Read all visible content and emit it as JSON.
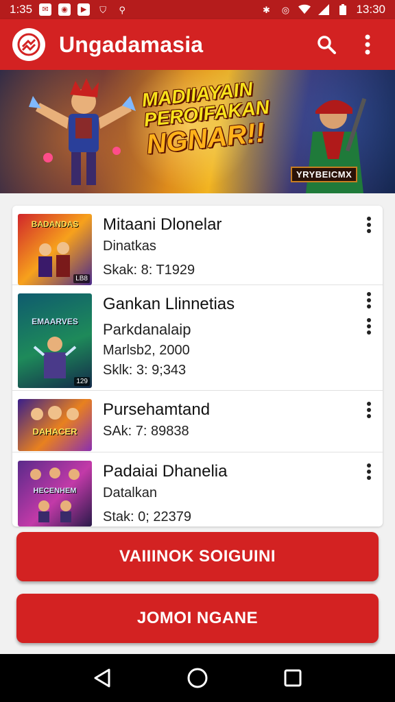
{
  "status_bar": {
    "time_left": "1:35",
    "time_right": "13:30",
    "left_icons": [
      "mail-icon",
      "camera-icon",
      "play-icon",
      "shield-icon",
      "usb-icon"
    ],
    "right_icons": [
      "bluetooth-icon",
      "vibrate-icon",
      "wifi-icon",
      "signal-icon",
      "battery-icon"
    ]
  },
  "app_bar": {
    "title": "Ungadamasia",
    "logo_icon": "app-logo-icon",
    "search_icon": "search-icon",
    "overflow_icon": "more-vert-icon"
  },
  "banner": {
    "headline_line1": "MADIIAYAIN",
    "headline_line2": "PEROIFAKAN",
    "headline_line3": "NGNAR!!",
    "tag": "YRYBEICMX"
  },
  "list": [
    {
      "title": "Mitaani Dlonelar",
      "line1": "Dinatkas",
      "meta": "Skak: 8: T1929",
      "thumb_label": "BADANDAS",
      "thumb_badge": "LB8",
      "thumb_colors": [
        "#d0262b",
        "#f7a11c",
        "#4a2a8c"
      ]
    },
    {
      "title": "Gankan Llinnetias",
      "line1": "Parkdanalaip",
      "line2": "Marlsb2, 2000",
      "meta": "Sklk: 3: 9;343",
      "thumb_label": "EMAARVES",
      "thumb_badge": "129",
      "thumb_colors": [
        "#0f5b6e",
        "#1e8a5a",
        "#132a4a"
      ]
    },
    {
      "title": "Pursehamtand",
      "meta": "SAk: 7: 89838",
      "thumb_label": "DAHACER",
      "thumb_badge": "",
      "thumb_colors": [
        "#3a1f8a",
        "#e8811f",
        "#8a2fb0"
      ]
    },
    {
      "title": "Padaiai Dhanelia",
      "line1": "Datalkan",
      "meta": "Stak: 0; 22379",
      "thumb_label": "HECENHEM",
      "thumb_badge": "",
      "thumb_colors": [
        "#5a2a8a",
        "#c23aa8",
        "#2a1a4a"
      ]
    }
  ],
  "buttons": {
    "primary": "VAIIINOK SOIGUINI",
    "secondary": "JOMOI NGANE"
  },
  "nav": {
    "back_icon": "back-icon",
    "home_icon": "home-icon",
    "recents_icon": "recents-icon"
  },
  "colors": {
    "primary": "#d32222",
    "status_bar": "#b51c1c",
    "nav_bar": "#000000"
  }
}
